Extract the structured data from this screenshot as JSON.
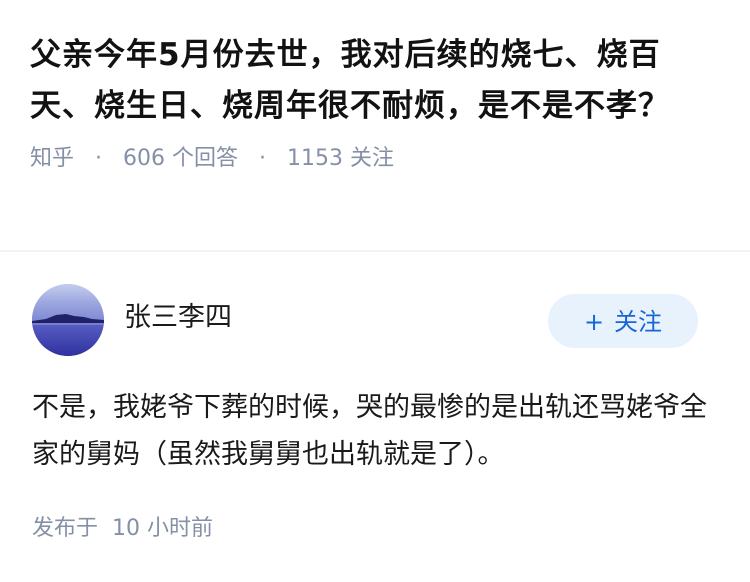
{
  "question": {
    "title": "父亲今年5月份去世，我对后续的烧七、烧百天、烧生日、烧周年很不耐烦，是不是不孝？",
    "source": "知乎",
    "separator": "·",
    "answers_count": "606",
    "answers_label": "个回答",
    "followers_count": "1153",
    "followers_label": "关注"
  },
  "answer": {
    "author": {
      "name": "张三李四",
      "avatar_icon": "landscape-avatar-icon"
    },
    "follow_button": {
      "icon": "plus-icon",
      "plus": "+",
      "label": "关注"
    },
    "content": "不是，我姥爷下葬的时候，哭的最惨的是出轨还骂姥爷全家的舅妈（虽然我舅舅也出轨就是了）。",
    "meta": {
      "published_label": "发布于",
      "time": "10 小时前"
    }
  },
  "colors": {
    "title": "#121212",
    "meta": "#8590a6",
    "follow_bg": "#e8f2fd",
    "follow_text": "#1766d6",
    "divider": "#f0f2f5"
  }
}
